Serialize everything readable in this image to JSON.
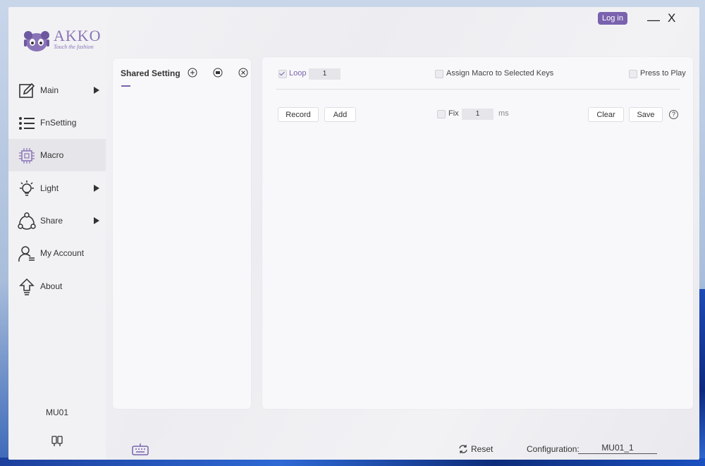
{
  "brand": {
    "name": "AKKO",
    "tagline": "Touch the fashion"
  },
  "header": {
    "login_label": "Log in",
    "minimize_label": "—",
    "close_label": "X"
  },
  "sidebar": {
    "items": [
      {
        "label": "Main",
        "icon": "edit-icon",
        "has_arrow": true
      },
      {
        "label": "FnSetting",
        "icon": "list-icon",
        "has_arrow": false
      },
      {
        "label": "Macro",
        "icon": "chip-icon",
        "has_arrow": false,
        "active": true
      },
      {
        "label": "Light",
        "icon": "bulb-icon",
        "has_arrow": true
      },
      {
        "label": "Share",
        "icon": "share-icon",
        "has_arrow": true
      },
      {
        "label": "My Account",
        "icon": "user-icon",
        "has_arrow": false
      },
      {
        "label": "About",
        "icon": "upload-arrow-icon",
        "has_arrow": false
      }
    ],
    "device_name": "MU01"
  },
  "shared_panel": {
    "title": "Shared Setting"
  },
  "macro": {
    "loop_label": "Loop",
    "loop_checked": true,
    "loop_value": "1",
    "assign_label": "Assign Macro to Selected Keys",
    "press_to_play_label": "Press to Play",
    "record_label": "Record",
    "add_label": "Add",
    "fix_label": "Fix",
    "fix_value": "1",
    "fix_unit": "ms",
    "clear_label": "Clear",
    "save_label": "Save",
    "help_label": "?"
  },
  "footer": {
    "reset_label": "Reset",
    "config_label": "Configuration:",
    "config_value": "MU01_1"
  },
  "colors": {
    "accent": "#7a62ae",
    "panel": "#f8f8fa",
    "sidebar": "#f2f2f4"
  }
}
